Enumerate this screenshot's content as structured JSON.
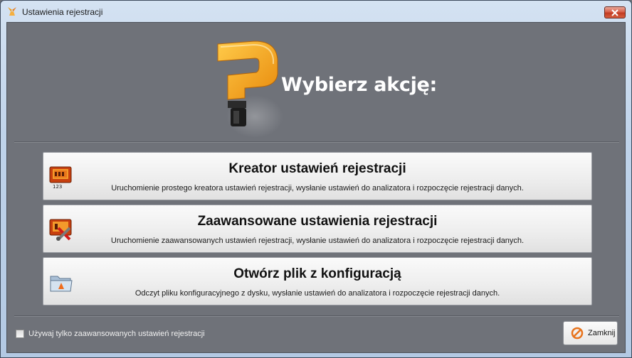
{
  "window": {
    "title": "Ustawienia rejestracji"
  },
  "header": {
    "heading": "Wybierz akcję:"
  },
  "actions": [
    {
      "title": "Kreator ustawień rejestracji",
      "description": "Uruchomienie prostego kreatora ustawień rejestracji, wysłanie ustawień do analizatora i rozpoczęcie rejestracji danych.",
      "icon": "wizard-icon",
      "icon_caption": "123"
    },
    {
      "title": "Zaawansowane ustawienia rejestracji",
      "description": "Uruchomienie zaawansowanych ustawień rejestracji, wysłanie ustawień do analizatora i rozpoczęcie rejestracji danych.",
      "icon": "advanced-settings-icon"
    },
    {
      "title": "Otwórz plik z konfiguracją",
      "description": "Odczyt pliku konfiguracyjnego z dysku, wysłanie ustawień do analizatora i rozpoczęcie rejestracji danych.",
      "icon": "open-folder-icon"
    }
  ],
  "footer": {
    "checkbox_label": "Używaj tylko zaawansowanych ustawień rejestracji",
    "checkbox_checked": false,
    "close_label": "Zamknij"
  },
  "colors": {
    "accent_orange": "#f4a11d",
    "client_bg": "#6f7279"
  }
}
